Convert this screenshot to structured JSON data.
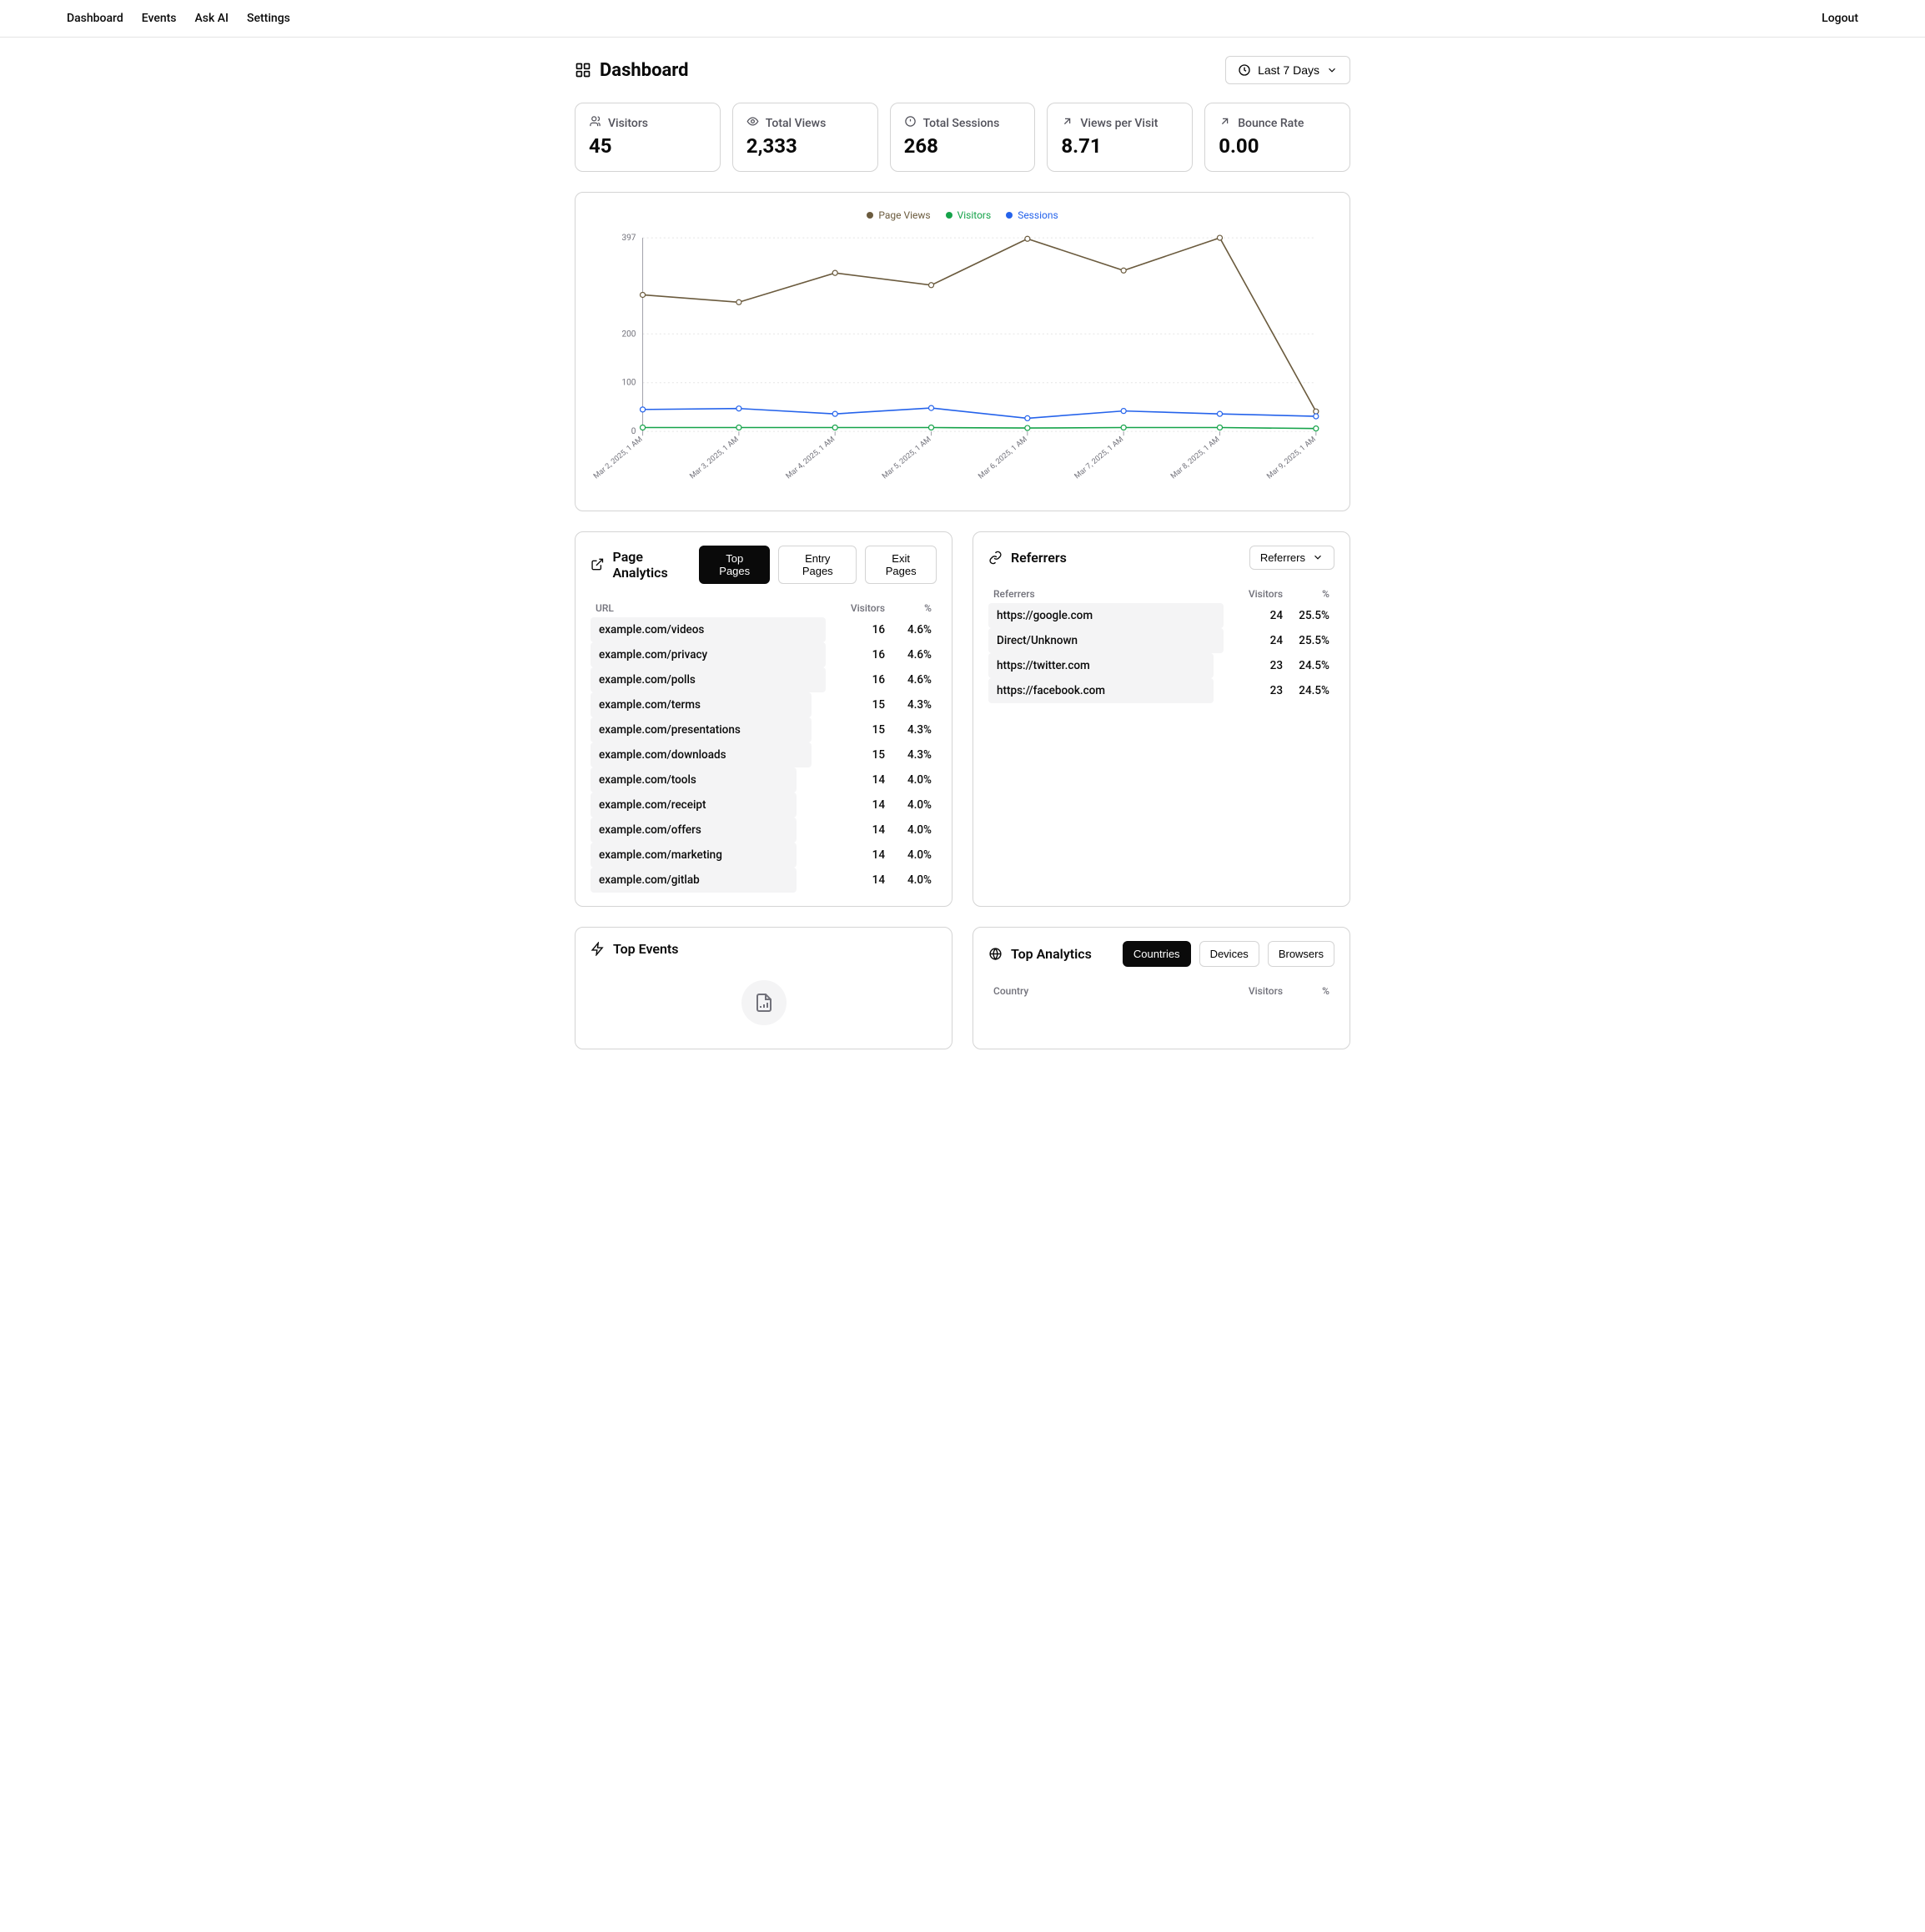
{
  "nav": {
    "items": [
      "Dashboard",
      "Events",
      "Ask AI",
      "Settings"
    ],
    "logout": "Logout"
  },
  "header": {
    "title": "Dashboard",
    "range_label": "Last 7 Days"
  },
  "stats": [
    {
      "label": "Visitors",
      "value": "45",
      "icon": "users"
    },
    {
      "label": "Total Views",
      "value": "2,333",
      "icon": "eye"
    },
    {
      "label": "Total Sessions",
      "value": "268",
      "icon": "clock-alert"
    },
    {
      "label": "Views per Visit",
      "value": "8.71",
      "icon": "arrow-up-right"
    },
    {
      "label": "Bounce Rate",
      "value": "0.00",
      "icon": "arrow-up-right"
    }
  ],
  "chart_data": {
    "type": "line",
    "title": "",
    "xlabel": "",
    "ylabel": "",
    "ylim": [
      0,
      397
    ],
    "y_ticks": [
      0,
      100,
      200,
      397
    ],
    "categories": [
      "Mar 2, 2025, 1 AM",
      "Mar 3, 2025, 1 AM",
      "Mar 4, 2025, 1 AM",
      "Mar 5, 2025, 1 AM",
      "Mar 6, 2025, 1 AM",
      "Mar 7, 2025, 1 AM",
      "Mar 8, 2025, 1 AM",
      "Mar 9, 2025, 1 AM"
    ],
    "series": [
      {
        "name": "Page Views",
        "color": "#6b5b3e",
        "values": [
          280,
          265,
          325,
          300,
          395,
          330,
          397,
          41
        ]
      },
      {
        "name": "Visitors",
        "color": "#16a34a",
        "values": [
          8,
          8,
          8,
          8,
          7,
          8,
          8,
          6
        ]
      },
      {
        "name": "Sessions",
        "color": "#2563eb",
        "values": [
          45,
          47,
          36,
          48,
          27,
          42,
          36,
          31
        ]
      }
    ],
    "legend_position": "top"
  },
  "page_analytics": {
    "title": "Page Analytics",
    "tabs": [
      "Top Pages",
      "Entry Pages",
      "Exit Pages"
    ],
    "active_tab": 0,
    "columns": [
      "URL",
      "Visitors",
      "%"
    ],
    "rows": [
      {
        "url": "example.com/videos",
        "visitors": 16,
        "pct": "4.6%"
      },
      {
        "url": "example.com/privacy",
        "visitors": 16,
        "pct": "4.6%"
      },
      {
        "url": "example.com/polls",
        "visitors": 16,
        "pct": "4.6%"
      },
      {
        "url": "example.com/terms",
        "visitors": 15,
        "pct": "4.3%"
      },
      {
        "url": "example.com/presentations",
        "visitors": 15,
        "pct": "4.3%"
      },
      {
        "url": "example.com/downloads",
        "visitors": 15,
        "pct": "4.3%"
      },
      {
        "url": "example.com/tools",
        "visitors": 14,
        "pct": "4.0%"
      },
      {
        "url": "example.com/receipt",
        "visitors": 14,
        "pct": "4.0%"
      },
      {
        "url": "example.com/offers",
        "visitors": 14,
        "pct": "4.0%"
      },
      {
        "url": "example.com/marketing",
        "visitors": 14,
        "pct": "4.0%"
      },
      {
        "url": "example.com/gitlab",
        "visitors": 14,
        "pct": "4.0%"
      }
    ]
  },
  "referrers": {
    "title": "Referrers",
    "dropdown_label": "Referrers",
    "columns": [
      "Referrers",
      "Visitors",
      "%"
    ],
    "rows": [
      {
        "name": "https://google.com",
        "visitors": 24,
        "pct": "25.5%"
      },
      {
        "name": "Direct/Unknown",
        "visitors": 24,
        "pct": "25.5%"
      },
      {
        "name": "https://twitter.com",
        "visitors": 23,
        "pct": "24.5%"
      },
      {
        "name": "https://facebook.com",
        "visitors": 23,
        "pct": "24.5%"
      }
    ]
  },
  "top_events": {
    "title": "Top Events"
  },
  "top_analytics": {
    "title": "Top Analytics",
    "tabs": [
      "Countries",
      "Devices",
      "Browsers"
    ],
    "active_tab": 0,
    "columns": [
      "Country",
      "Visitors",
      "%"
    ]
  }
}
